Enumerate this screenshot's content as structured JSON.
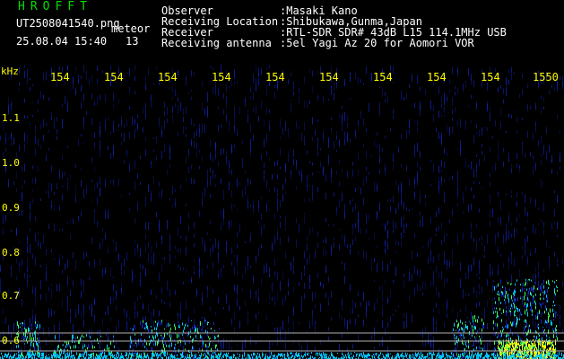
{
  "header": {
    "logo": "HROFFT",
    "filename": "UT2508041540.png",
    "tag": "meteor",
    "datetime": "25.08.04 15:40",
    "count": "13",
    "info_rows": [
      {
        "label": "Observer",
        "value": ":Masaki Kano"
      },
      {
        "label": "Receiving Location",
        "value": ":Shibukawa,Gunma,Japan"
      },
      {
        "label": "Receiver",
        "value": ":RTL-SDR SDR# 43dB L15 114.1MHz USB"
      },
      {
        "label": "Receiving antenna",
        "value": ":5el Yagi Az 20 for Aomori VOR"
      }
    ]
  },
  "axis": {
    "unit": "kHz",
    "y_ticks": [
      "1.1",
      "1.0",
      "0.9",
      "0.8",
      "0.7",
      "0.6"
    ],
    "x_ticks": [
      "154",
      "154",
      "154",
      "154",
      "154",
      "154",
      "154",
      "154",
      "154",
      "1550"
    ]
  },
  "colors": {
    "logo": "#00e000",
    "text": "#ffffff",
    "axis_text": "#ffff00",
    "background": "#000000",
    "noise": "#1428c8",
    "signal_cyan": "#00c8ff",
    "signal_green": "#40ff60",
    "signal_yellow": "#ffff00"
  }
}
